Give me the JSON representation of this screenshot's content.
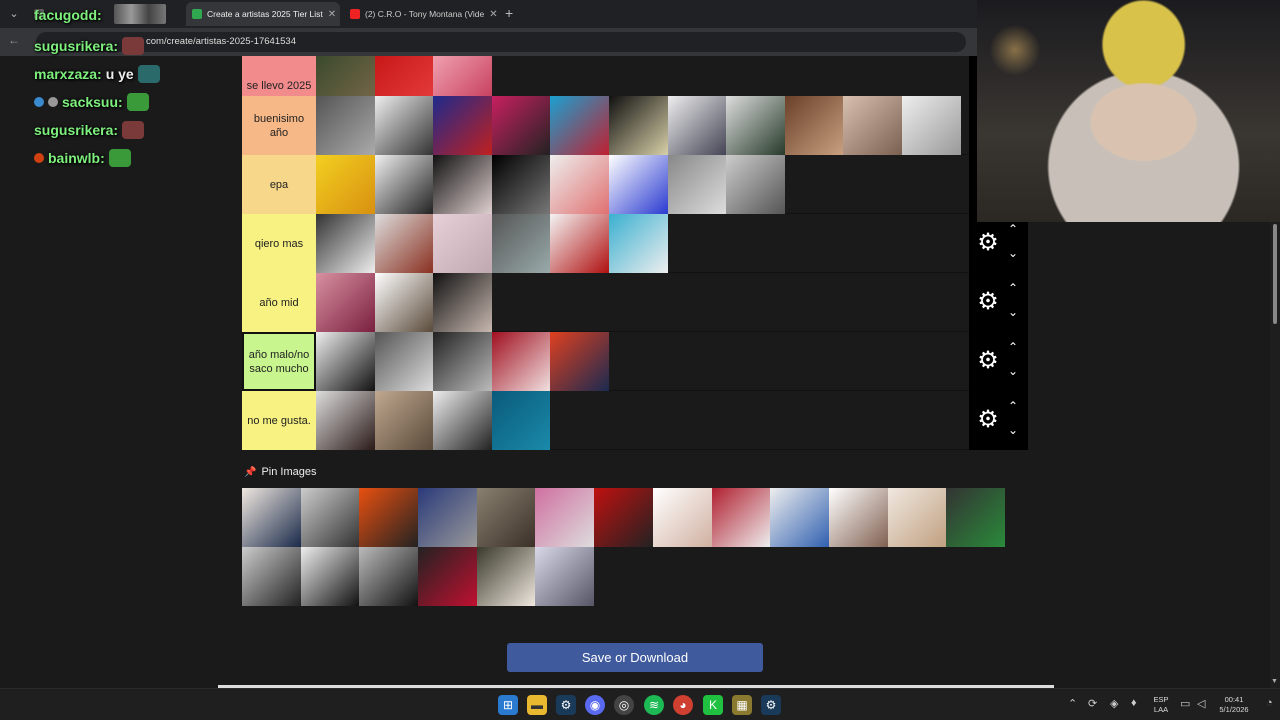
{
  "browser": {
    "tabs": [
      {
        "label": "",
        "active": false
      },
      {
        "label": "Create a artistas 2025 Tier List",
        "active": true
      },
      {
        "label": "(2) C.R.O - Tony Montana (Vide",
        "active": false
      }
    ],
    "new_tab": "+",
    "url": "com/create/artistas-2025-17641534"
  },
  "tiers": [
    {
      "label": "se llevo 2025",
      "color": "#f28b8b",
      "count": 3
    },
    {
      "label": "buenisimo año",
      "color": "#f6b886",
      "count": 11
    },
    {
      "label": "epa",
      "color": "#f7d88a",
      "count": 8
    },
    {
      "label": "qiero mas",
      "color": "#f7f282",
      "count": 6
    },
    {
      "label": "año mid",
      "color": "#f7f282",
      "count": 3
    },
    {
      "label": "año malo/no saco mucho",
      "color": "#c8f58e",
      "count": 5
    },
    {
      "label": "no me gusta.",
      "color": "#f7f282",
      "count": 4
    }
  ],
  "tier_controls": {
    "gear": "⚙",
    "up": "⌃",
    "down": "⌄"
  },
  "pin_section": {
    "title": "Pin Images",
    "icon": "pushpin-icon",
    "count": 19
  },
  "save_button": "Save or Download",
  "chat": [
    {
      "user": "facugodd:",
      "msg": "",
      "color": "#7ef07e"
    },
    {
      "user": "sugusrikera:",
      "msg": "",
      "color": "#7ef07e"
    },
    {
      "user": "marxzaza:",
      "msg": "u ye",
      "color": "#7ef07e"
    },
    {
      "user": "sacksuu:",
      "msg": "",
      "color": "#7ef07e"
    },
    {
      "user": "sugusrikera:",
      "msg": "",
      "color": "#7ef07e"
    },
    {
      "user": "bainwlb:",
      "msg": "",
      "color": "#7ef07e"
    }
  ],
  "taskbar": {
    "lang_top": "ESP",
    "lang_bottom": "LAA",
    "time": "00:41",
    "date": "5/1/2026"
  }
}
